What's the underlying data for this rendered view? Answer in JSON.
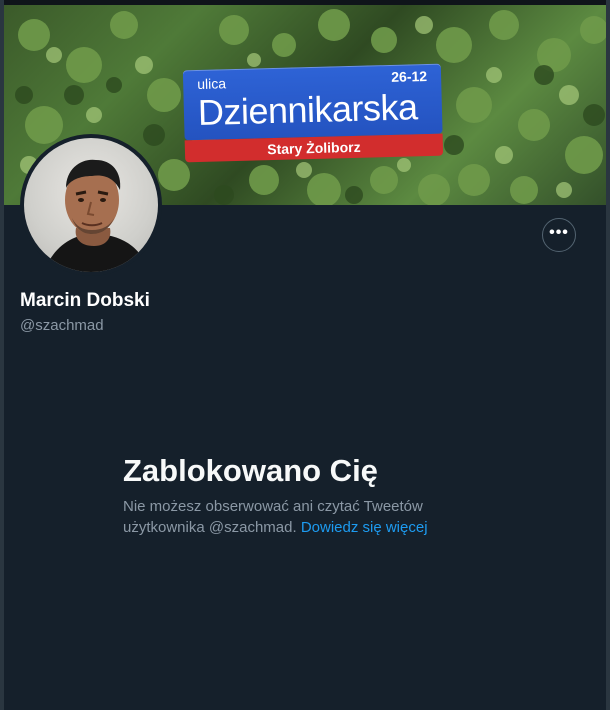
{
  "banner": {
    "sign_prefix": "ulica",
    "sign_name": "Dziennikarska",
    "sign_number": "26-12",
    "sign_district": "Stary Żoliborz"
  },
  "profile": {
    "display_name": "Marcin Dobski",
    "handle": "@szachmad",
    "more_icon": "ellipsis-icon",
    "more_label": "•••"
  },
  "blocked": {
    "title": "Zablokowano Cię",
    "message_prefix": "Nie możesz obserwować ani czytać Tweetów użytkownika @szachmad.",
    "learn_more": "Dowiedz się więcej"
  },
  "colors": {
    "background": "#15202b",
    "link": "#1d9bf0",
    "secondary_text": "#8b98a5"
  }
}
